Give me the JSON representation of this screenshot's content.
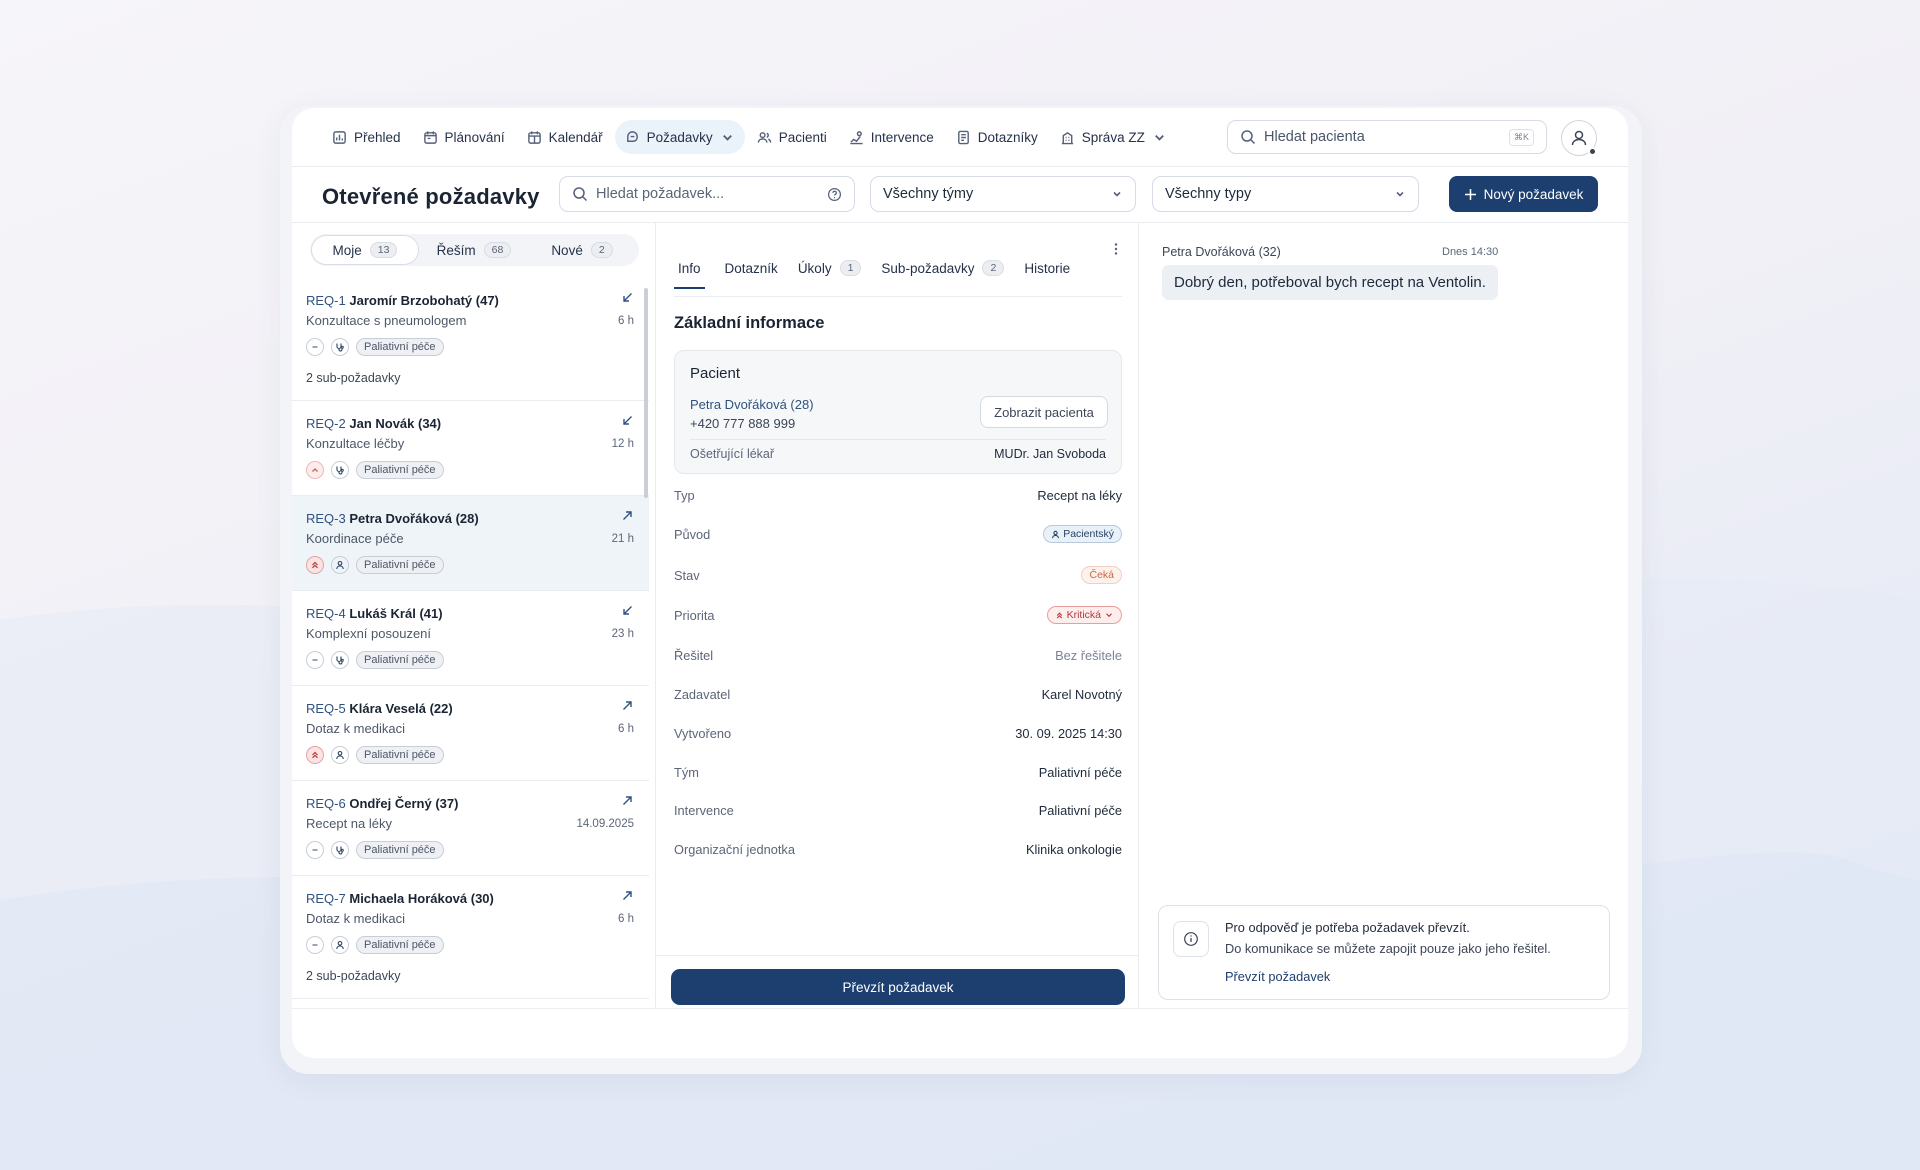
{
  "nav": {
    "items": [
      {
        "label": "Přehled",
        "icon": "dashboard-icon"
      },
      {
        "label": "Plánování",
        "icon": "calendar-plan-icon"
      },
      {
        "label": "Kalendář",
        "icon": "calendar-icon"
      },
      {
        "label": "Požadavky",
        "icon": "requests-icon",
        "active": true
      },
      {
        "label": "Pacienti",
        "icon": "users-icon"
      },
      {
        "label": "Intervence",
        "icon": "intervention-icon"
      },
      {
        "label": "Dotazníky",
        "icon": "questionnaire-icon"
      },
      {
        "label": "Správa ZZ",
        "icon": "building-icon"
      }
    ],
    "search_placeholder": "Hledat pacienta",
    "search_shortcut": "⌘K"
  },
  "header": {
    "title": "Otevřené požadavky",
    "search_placeholder": "Hledat požadavek...",
    "team_filter": "Všechny týmy",
    "type_filter": "Všechny typy",
    "new_button": "Nový požadavek"
  },
  "segments": [
    {
      "label": "Moje",
      "count": "13",
      "active": true
    },
    {
      "label": "Řeším",
      "count": "68"
    },
    {
      "label": "Nové",
      "count": "2"
    }
  ],
  "requests": [
    {
      "id": "REQ-1",
      "name": "Jaromír Brzobohatý (47)",
      "desc": "Konzultace s pneumologem",
      "time": "6 h",
      "direction": "incoming",
      "priority": "normal",
      "kind": "stethoscope",
      "tag": "Paliativní péče",
      "sub": "2 sub-požadavky"
    },
    {
      "id": "REQ-2",
      "name": "Jan Novák (34)",
      "desc": "Konzultace léčby",
      "time": "12 h",
      "direction": "incoming",
      "priority": "high",
      "kind": "stethoscope",
      "tag": "Paliativní péče",
      "sub": ""
    },
    {
      "id": "REQ-3",
      "name": "Petra Dvořáková (28)",
      "desc": "Koordinace péče",
      "time": "21 h",
      "direction": "outgoing",
      "priority": "critical",
      "kind": "person",
      "tag": "Paliativní péče",
      "sub": "",
      "selected": true
    },
    {
      "id": "REQ-4",
      "name": "Lukáš Král (41)",
      "desc": "Komplexní posouzení",
      "time": "23 h",
      "direction": "incoming",
      "priority": "normal",
      "kind": "stethoscope",
      "tag": "Paliativní péče",
      "sub": ""
    },
    {
      "id": "REQ-5",
      "name": "Klára Veselá (22)",
      "desc": "Dotaz k medikaci",
      "time": "6 h",
      "direction": "outgoing",
      "priority": "critical",
      "kind": "person",
      "tag": "Paliativní péče",
      "sub": ""
    },
    {
      "id": "REQ-6",
      "name": "Ondřej Černý (37)",
      "desc": "Recept na léky",
      "time": "14.09.2025",
      "direction": "outgoing",
      "priority": "normal",
      "kind": "stethoscope",
      "tag": "Paliativní péče",
      "sub": ""
    },
    {
      "id": "REQ-7",
      "name": "Michaela Horáková (30)",
      "desc": "Dotaz k medikaci",
      "time": "6 h",
      "direction": "outgoing",
      "priority": "normal",
      "kind": "person",
      "tag": "Paliativní péče",
      "sub": "2 sub-požadavky"
    }
  ],
  "detail": {
    "tabs": [
      {
        "label": "Info",
        "active": true
      },
      {
        "label": "Dotazník"
      },
      {
        "label": "Úkoly",
        "count": "1"
      },
      {
        "label": "Sub-požadavky",
        "count": "2"
      },
      {
        "label": "Historie"
      }
    ],
    "section_title": "Základní informace",
    "patient": {
      "label": "Pacient",
      "name": "Petra Dvořáková (28)",
      "phone": "+420 777 888 999",
      "show_button": "Zobrazit pacienta",
      "doctor_label": "Ošetřující lékař",
      "doctor": "MUDr. Jan Svoboda"
    },
    "fields": [
      {
        "key": "Typ",
        "value": "Recept na léky"
      },
      {
        "key": "Původ",
        "value": "Pacientský",
        "badge": "blue"
      },
      {
        "key": "Stav",
        "value": "Čeká",
        "badge": "orange"
      },
      {
        "key": "Priorita",
        "value": "Kritická",
        "badge": "red"
      },
      {
        "key": "Řešitel",
        "value": "Bez řešitele",
        "muted": true
      },
      {
        "key": "Zadavatel",
        "value": "Karel Novotný"
      },
      {
        "key": "Vytvořeno",
        "value": "30. 09. 2025 14:30"
      },
      {
        "key": "Tým",
        "value": "Paliativní péče"
      },
      {
        "key": "Intervence",
        "value": "Paliativní péče"
      },
      {
        "key": "Organizační jednotka",
        "value": "Klinika onkologie"
      }
    ],
    "take_button": "Převzít požadavek"
  },
  "chat": {
    "sender": "Petra Dvořáková (32)",
    "time": "Dnes 14:30",
    "message": "Dobrý den, potřeboval bych recept na Ventolin.",
    "notice_title": "Pro odpověď je potřeba požadavek převzít.",
    "notice_text": "Do komunikace se můžete zapojit pouze jako jeho řešitel.",
    "notice_link": "Převzít požadavek"
  },
  "colors": {
    "primary": "#1d3f70",
    "critical": "#b23a3a",
    "waiting": "#d2663b"
  }
}
